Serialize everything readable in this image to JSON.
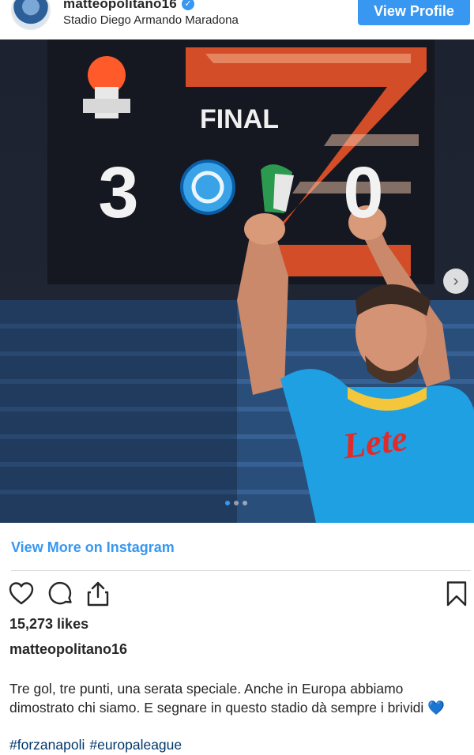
{
  "header": {
    "username": "matteopolitano16",
    "verified_glyph": "✓",
    "location": "Stadio Diego Armando Maradona",
    "view_profile_label": "View Profile"
  },
  "photo": {
    "scoreboard_label": "FINAL",
    "home_score": "3",
    "away_score": "0",
    "shirt_text": "Lete",
    "carousel_next_glyph": "›",
    "carousel": {
      "total": 3,
      "active": 1
    }
  },
  "view_more_label": "View More on Instagram",
  "actions": {
    "like_icon": "heart-icon",
    "comment_icon": "comment-icon",
    "share_icon": "share-icon",
    "save_icon": "bookmark-icon"
  },
  "likes": "15,273 likes",
  "caption": {
    "username": "matteopolitano16",
    "text": "Tre gol, tre punti, una serata speciale. Anche in Europa abbiamo dimostrato chi siamo. E segnare in questo stadio dà sempre i brividi 💙",
    "hashtags": [
      "#forzanapoli",
      "#europaleague"
    ]
  },
  "colors": {
    "accent": "#3897f0",
    "hashtag": "#00376b",
    "text": "#262626",
    "scoreboard_orange": "#ff5a2a"
  }
}
